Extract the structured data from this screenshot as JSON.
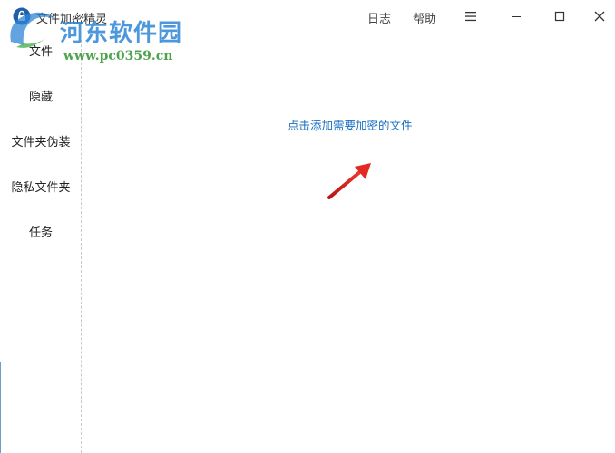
{
  "window": {
    "title": "文件加密精灵",
    "menu_log": "日志",
    "menu_help": "帮助"
  },
  "watermark": {
    "site_name": "河东软件园",
    "site_url": "www.pc0359.cn"
  },
  "sidebar": {
    "items": [
      {
        "label": "文件"
      },
      {
        "label": "隐藏"
      },
      {
        "label": "文件夹伪装"
      },
      {
        "label": "隐私文件夹"
      },
      {
        "label": "任务"
      }
    ]
  },
  "main": {
    "add_file_hint": "点击添加需要加密的文件"
  },
  "colors": {
    "accent": "#1a6fc0",
    "arrow": "#d9201f",
    "watermark_blue": "#2f86d6",
    "watermark_green": "#3a9a3a"
  },
  "icons": {
    "app": "lock-icon",
    "menu": "hamburger-icon",
    "minimize": "minimize-icon",
    "maximize": "maximize-icon",
    "close": "close-icon"
  }
}
